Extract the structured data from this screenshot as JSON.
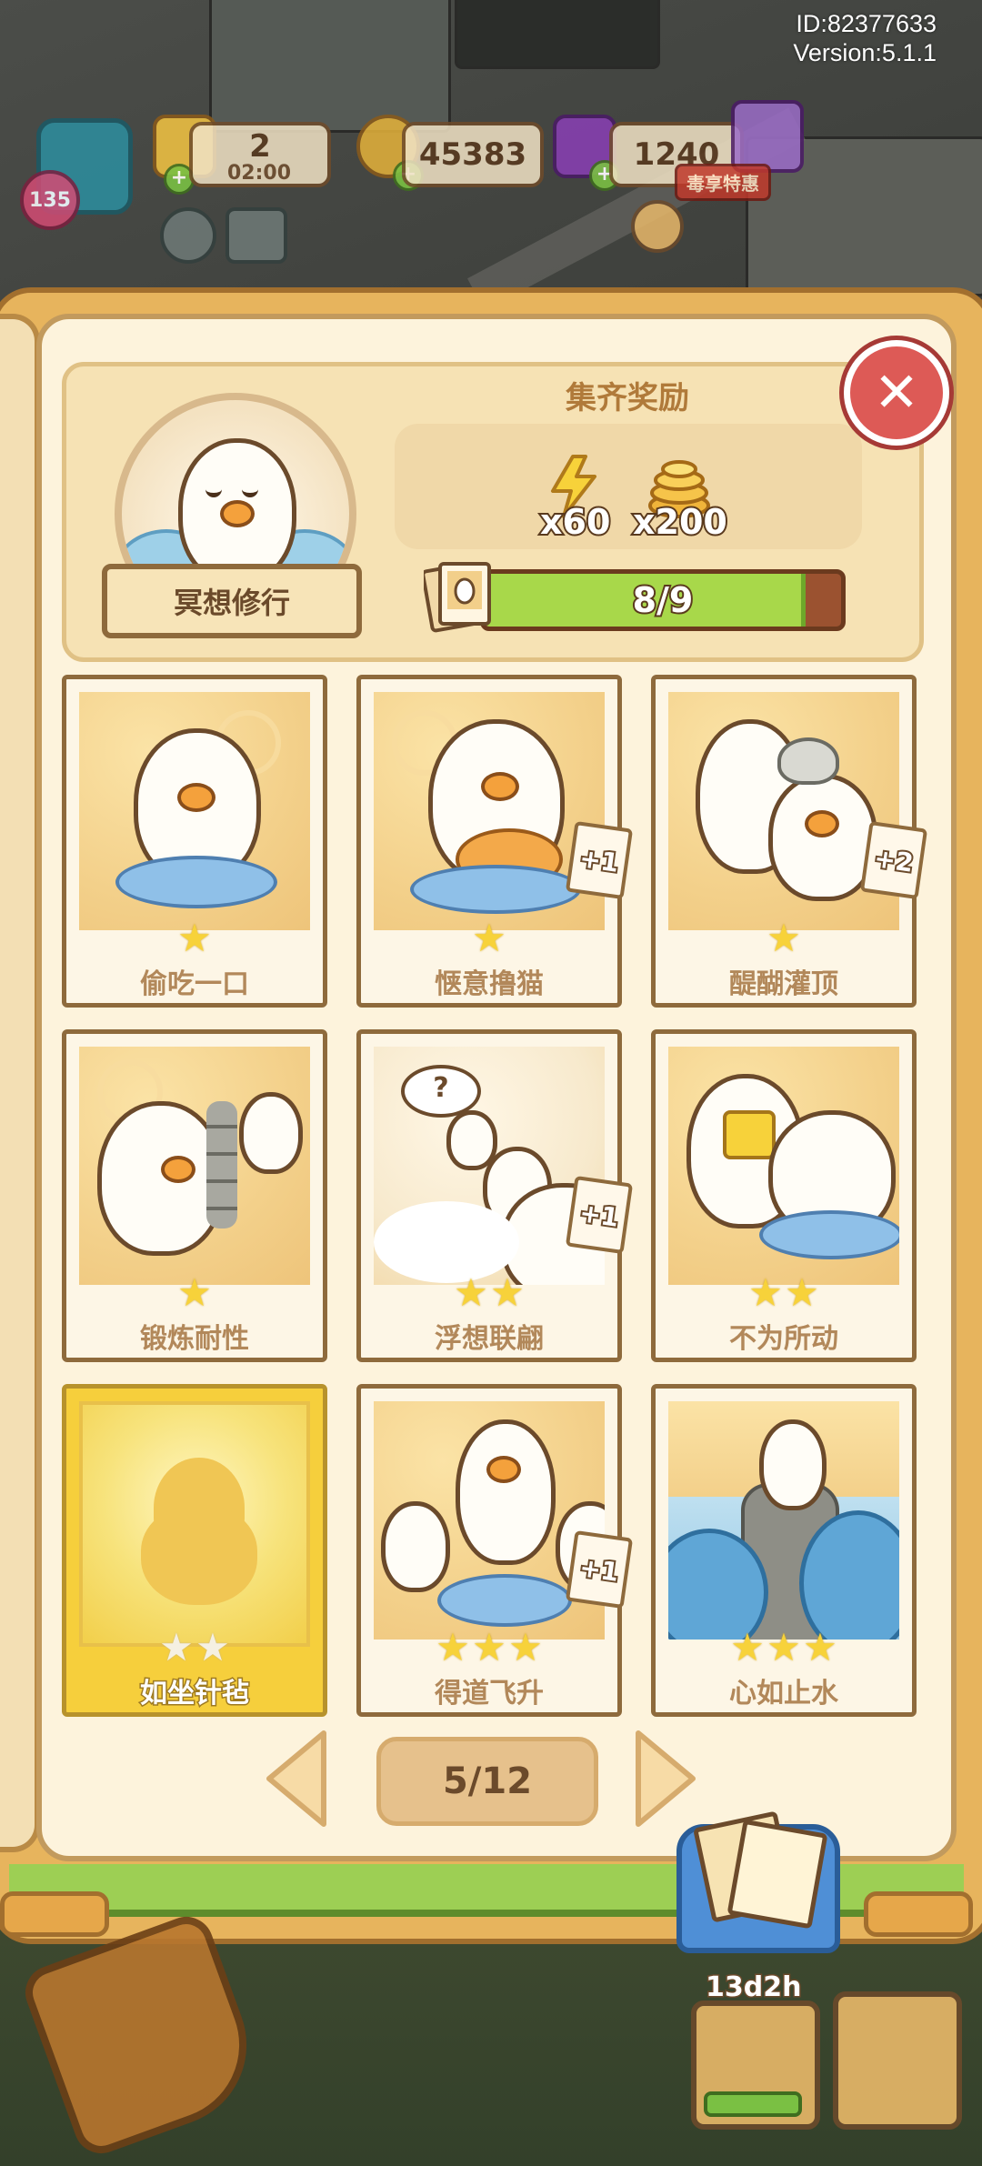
{
  "meta": {
    "id": "ID:82377633",
    "version": "Version:5.1.1"
  },
  "hud": {
    "energy_value": "2",
    "energy_timer": "02:00",
    "coins_value": "45383",
    "gems_value": "1240",
    "promo_label": "毒享特惠",
    "level": "135"
  },
  "album": {
    "set_name": "冥想修行",
    "reward_title": "集齐奖励",
    "rewards": [
      {
        "icon": "lightning-icon",
        "amount": "x60"
      },
      {
        "icon": "gold-coins-icon",
        "amount": "x200"
      }
    ],
    "progress_text": "8/9",
    "progress_fraction": 0.889,
    "close_symbol": "✕"
  },
  "cards": [
    {
      "title": "偷吃一口",
      "stars": 1,
      "extra": "",
      "style": "normal"
    },
    {
      "title": "惬意撸猫",
      "stars": 1,
      "extra": "+1",
      "style": "normal"
    },
    {
      "title": "醍醐灌顶",
      "stars": 1,
      "extra": "+2",
      "style": "normal"
    },
    {
      "title": "锻炼耐性",
      "stars": 1,
      "extra": "",
      "style": "normal"
    },
    {
      "title": "浮想联翩",
      "stars": 2,
      "extra": "+1",
      "style": "normal"
    },
    {
      "title": "不为所动",
      "stars": 2,
      "extra": "",
      "style": "normal"
    },
    {
      "title": "如坐针毡",
      "stars": 2,
      "extra": "",
      "style": "gold"
    },
    {
      "title": "得道飞升",
      "stars": 3,
      "extra": "+1",
      "style": "normal"
    },
    {
      "title": "心如止水",
      "stars": 3,
      "extra": "",
      "style": "normal"
    }
  ],
  "pagination": {
    "label": "5/12"
  },
  "bottom": {
    "timer": "13d2h"
  },
  "colors": {
    "accent_green": "#a8d84a",
    "star_gold": "#f7d23a",
    "close_red": "#dd5a56"
  }
}
